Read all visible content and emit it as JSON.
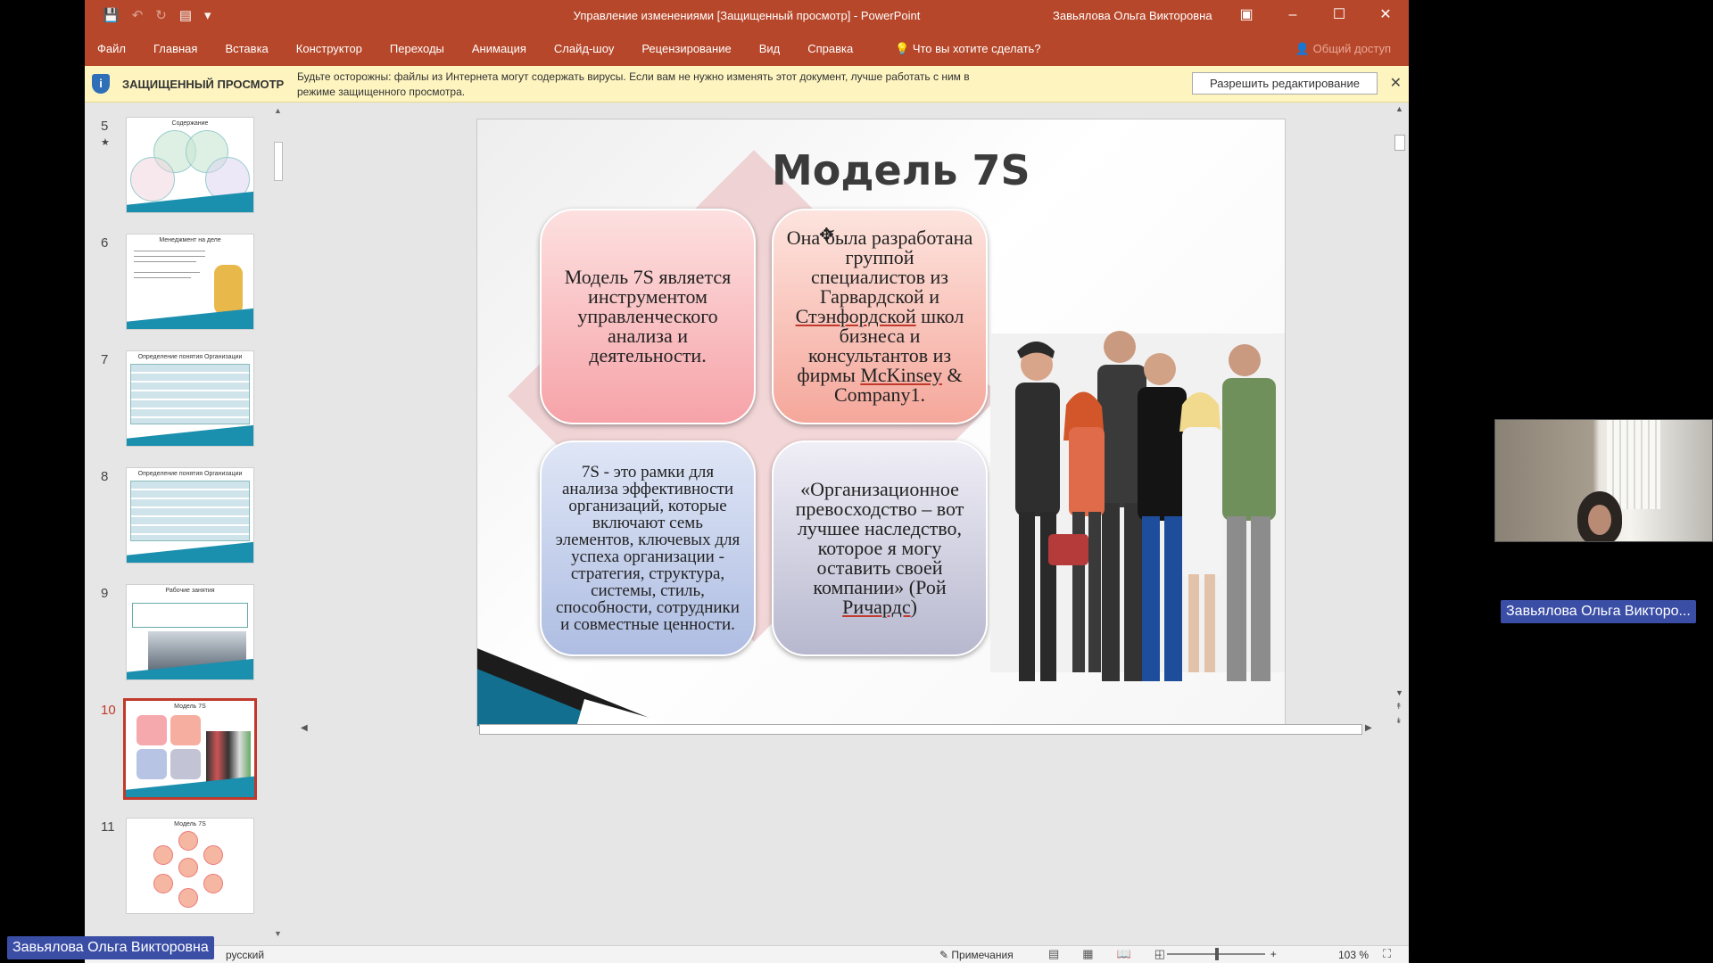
{
  "window": {
    "title": "Управление изменениями [Защищенный просмотр]  -  PowerPoint",
    "user": "Завьялова Ольга Викторовна"
  },
  "menu": {
    "tabs": [
      "Файл",
      "Главная",
      "Вставка",
      "Конструктор",
      "Переходы",
      "Анимация",
      "Слайд-шоу",
      "Рецензирование",
      "Вид",
      "Справка"
    ],
    "tell_me": "Что вы хотите сделать?",
    "share": "Общий доступ"
  },
  "protected_view": {
    "title": "ЗАЩИЩЕННЫЙ ПРОСМОТР",
    "message": "Будьте осторожны: файлы из Интернета могут содержать вирусы. Если вам не нужно изменять этот документ, лучше работать с ним в режиме защищенного просмотра.",
    "enable_button": "Разрешить редактирование"
  },
  "thumbnails": [
    {
      "num": "5",
      "star": "★",
      "title": "Содержание"
    },
    {
      "num": "6",
      "title": "Менеджмент на деле"
    },
    {
      "num": "7",
      "title": "Определение понятия Организации"
    },
    {
      "num": "8",
      "title": "Определение понятия Организации"
    },
    {
      "num": "9",
      "title": "Рабочие занятия"
    },
    {
      "num": "10",
      "title": "Модель 7S",
      "active": true
    },
    {
      "num": "11",
      "title": "Модель 7S"
    }
  ],
  "slide": {
    "title": "Модель 7S",
    "box1": "Модель 7S является инструментом управленческого анализа и деятельности.",
    "box2_a": "Она была разработана группой специалистов из Гарвардской и",
    "box2_u1": "Стэнфордской",
    "box2_b": "школ бизнеса и консультантов из фирмы",
    "box2_u2": "McKinsey",
    "box2_c": "& Company1.",
    "box3": "7S - это рамки для анализа эффективности организаций, которые включают семь элементов, ключевых для успеха организации - стратегия, структура, системы, стиль, способности, сотрудники и совместные ценности.",
    "box4_a": "«Организационное превосходство – вот лучшее наследство, которое я могу оставить своей компании» (Рой",
    "box4_u": "Ричардс",
    "box4_b": ")"
  },
  "status": {
    "language": "русский",
    "notes": "Примечания",
    "zoom": "103 %"
  },
  "call": {
    "participant_name": "Завьялова Ольга Викторо...",
    "host_name": "Завьялова Ольга Викторовна"
  },
  "colors": {
    "ribbon": "#b7472a",
    "active_thumb": "#c0392b",
    "name_tag": "#3b4ea6"
  }
}
